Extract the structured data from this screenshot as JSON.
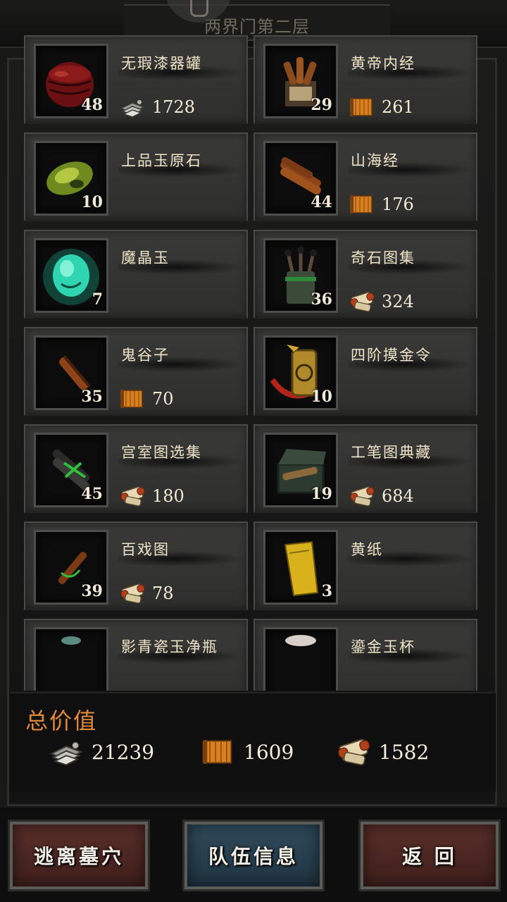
{
  "header": {
    "title": "两界门第二层"
  },
  "items": [
    {
      "name": "无瑕漆器罐",
      "qty": "48",
      "price": "1728",
      "currency": "silver",
      "icon": "lacquer-jar-icon"
    },
    {
      "name": "黄帝内经",
      "qty": "29",
      "price": "261",
      "currency": "scroll",
      "icon": "bamboo-book-icon"
    },
    {
      "name": "上品玉原石",
      "qty": "10",
      "price": "",
      "currency": "",
      "icon": "jade-stone-icon"
    },
    {
      "name": "山海经",
      "qty": "44",
      "price": "176",
      "currency": "scroll",
      "icon": "scroll-bundle-icon"
    },
    {
      "name": "魔晶玉",
      "qty": "7",
      "price": "",
      "currency": "",
      "icon": "magic-jade-icon"
    },
    {
      "name": "奇石图集",
      "qty": "36",
      "price": "324",
      "currency": "map",
      "icon": "scroll-quiver-icon"
    },
    {
      "name": "鬼谷子",
      "qty": "35",
      "price": "70",
      "currency": "scroll",
      "icon": "rolled-scroll-icon"
    },
    {
      "name": "四阶摸金令",
      "qty": "10",
      "price": "",
      "currency": "",
      "icon": "gold-token-icon"
    },
    {
      "name": "宫室图选集",
      "qty": "45",
      "price": "180",
      "currency": "map",
      "icon": "tied-scrolls-icon"
    },
    {
      "name": "工笔图典藏",
      "qty": "19",
      "price": "684",
      "currency": "map",
      "icon": "scroll-chest-icon"
    },
    {
      "name": "百戏图",
      "qty": "39",
      "price": "78",
      "currency": "map",
      "icon": "single-scroll-icon"
    },
    {
      "name": "黄纸",
      "qty": "3",
      "price": "",
      "currency": "",
      "icon": "yellow-paper-icon"
    },
    {
      "name": "影青瓷玉净瓶",
      "qty": "",
      "price": "",
      "currency": "",
      "icon": "vase-icon"
    },
    {
      "name": "鎏金玉杯",
      "qty": "",
      "price": "",
      "currency": "",
      "icon": "cup-icon"
    }
  ],
  "totals": {
    "label": "总价值",
    "silver": "21239",
    "scroll": "1609",
    "map": "1582"
  },
  "buttons": {
    "escape": "逃离墓穴",
    "team": "队伍信息",
    "back": "返 回"
  },
  "colors": {
    "accent_orange": "#e08a3a",
    "card_bg": "#353534",
    "escape_btn": "#4e2a26",
    "team_btn": "#2a4252"
  }
}
